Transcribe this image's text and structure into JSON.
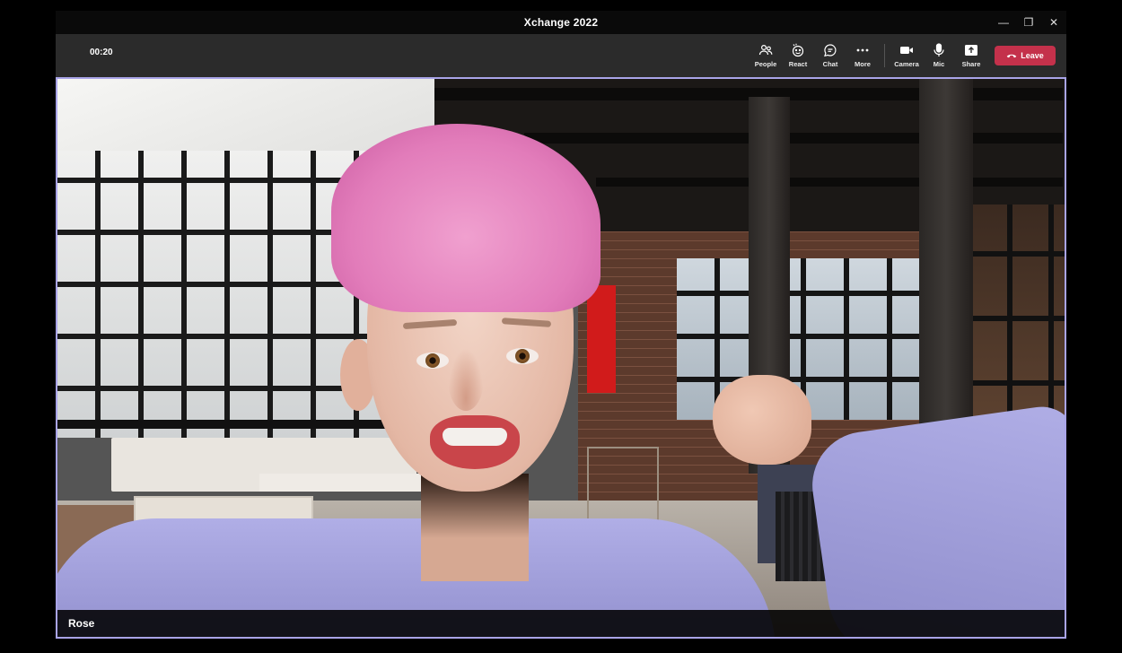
{
  "window": {
    "title": "Xchange 2022",
    "controls": [
      "—",
      "❐",
      "✕"
    ]
  },
  "toolbar": {
    "timer": "00:20",
    "tools": [
      {
        "label": "People",
        "icon": "people-icon"
      },
      {
        "label": "React",
        "icon": "react-icon"
      },
      {
        "label": "Chat",
        "icon": "chat-icon"
      },
      {
        "label": "More",
        "icon": "more-icon"
      },
      {
        "label": "Camera",
        "icon": "camera-icon"
      },
      {
        "label": "Mic",
        "icon": "mic-icon"
      },
      {
        "label": "Share",
        "icon": "share-icon"
      }
    ],
    "leave_label": "Leave",
    "leave_color": "#c4314b"
  },
  "stage": {
    "participant_name": "Rose",
    "active_speaker_border": "#a9a4e8"
  }
}
